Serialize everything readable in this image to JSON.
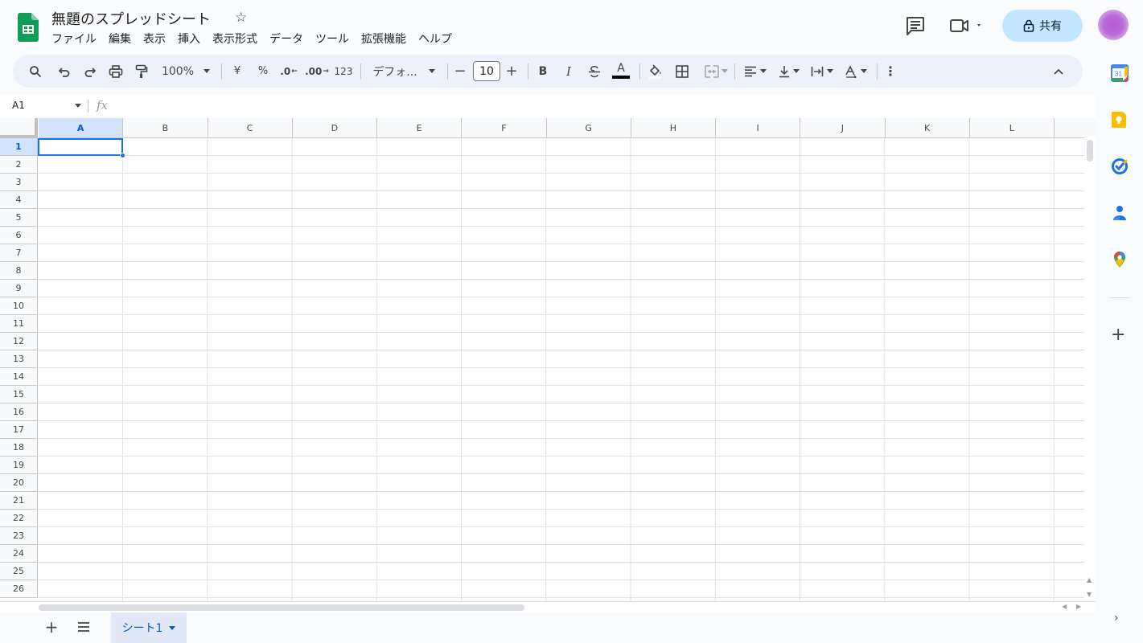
{
  "header": {
    "title": "無題のスプレッドシート",
    "star_icon": "star-icon",
    "share_label": "共有"
  },
  "menu": [
    "ファイル",
    "編集",
    "表示",
    "挿入",
    "表示形式",
    "データ",
    "ツール",
    "拡張機能",
    "ヘルプ"
  ],
  "toolbar": {
    "zoom": "100%",
    "currency": "¥",
    "percent": "%",
    "dec_decrease": ".0",
    "dec_increase": ".00",
    "number_format": "123",
    "font": "デフォ...",
    "font_size": "10",
    "bold": "B",
    "italic": "I",
    "text_color_letter": "A",
    "text_color": "#000000"
  },
  "formula_bar": {
    "name_box": "A1",
    "fx": "fx"
  },
  "columns": [
    "A",
    "B",
    "C",
    "D",
    "E",
    "F",
    "G",
    "H",
    "I",
    "J",
    "K",
    "L"
  ],
  "rows": [
    "1",
    "2",
    "3",
    "4",
    "5",
    "6",
    "7",
    "8",
    "9",
    "10",
    "11",
    "12",
    "13",
    "14",
    "15",
    "16",
    "17",
    "18",
    "19",
    "20",
    "21",
    "22",
    "23",
    "24",
    "25",
    "26"
  ],
  "selected_cell": "A1",
  "sheets": {
    "active": "シート1"
  },
  "side_panel": {
    "calendar_label": "31"
  },
  "colors": {
    "accent": "#1a73e8",
    "share_bg": "#c2e7ff",
    "sheets_green": "#0f9d58"
  }
}
